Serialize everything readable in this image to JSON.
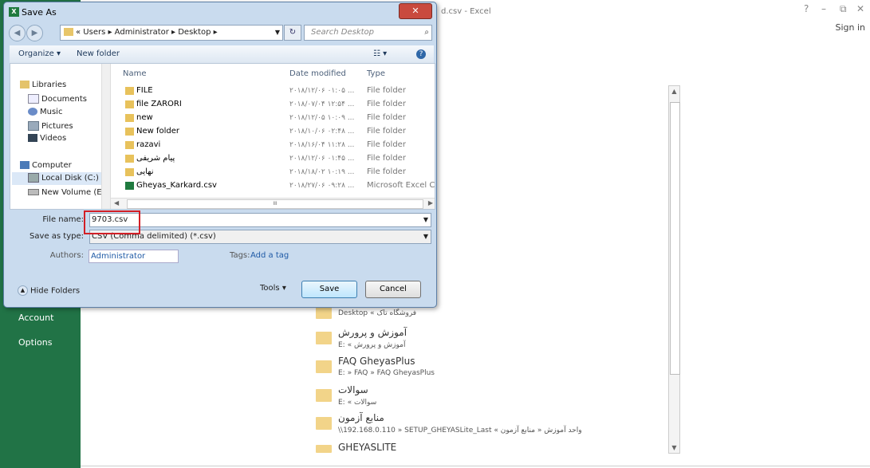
{
  "excel": {
    "title_fragment": "d.csv - Excel",
    "help": "?",
    "minimize": "–",
    "restore": "⧉",
    "close": "✕",
    "sign_in": "Sign in",
    "menu": [
      "Account",
      "Options"
    ],
    "recent": [
      {
        "name": "",
        "path": "Desktop « فروشگاه تاک"
      },
      {
        "name": "آموزش و پرورش",
        "path": "E: « آموزش و پرورش"
      },
      {
        "name": "FAQ GheyasPlus",
        "path": "E: » FAQ » FAQ GheyasPlus"
      },
      {
        "name": "سوالات",
        "path": "E: « سوالات"
      },
      {
        "name": "منابع آزمون",
        "path": "\\\\192.168.0.110 » SETUP_GHEYASLite_Last « واحد آموزش « منابع آزمون"
      },
      {
        "name": "GHEYASLITE",
        "path": ""
      }
    ]
  },
  "dialog": {
    "icon_label": "X",
    "title": "Save As",
    "close_label": "✕",
    "back": "◀",
    "forward": "▶",
    "address_crumbs": "« Users ▸ Administrator ▸ Desktop ▸",
    "refresh": "↻",
    "search_placeholder": "Search Desktop",
    "search_icon": "🔍",
    "toolbar": {
      "organize": "Organize ▾",
      "new_folder": "New folder",
      "views": "☷ ▾",
      "help": "?"
    },
    "nav_tree": [
      "Libraries",
      "Documents",
      "Music",
      "Pictures",
      "Videos",
      "Computer",
      "Local Disk (C:)",
      "New Volume (E:)"
    ],
    "columns": {
      "name": "Name",
      "date": "Date modified",
      "type": "Type"
    },
    "files": [
      {
        "name": "FILE",
        "date": "۲۰۱۸/۱۲/۰۶ ۰۱:۰۵ ...",
        "type": "File folder",
        "icon": "folder"
      },
      {
        "name": "file ZARORI",
        "date": "۲۰۱۸/۰۷/۰۴ ۱۲:۵۴ ...",
        "type": "File folder",
        "icon": "folder"
      },
      {
        "name": "new",
        "date": "۲۰۱۸/۱۲/۰۵ ۱۰:۰۹ ...",
        "type": "File folder",
        "icon": "folder"
      },
      {
        "name": "New folder",
        "date": "۲۰۱۸/۱۰/۰۶ ۰۲:۴۸ ...",
        "type": "File folder",
        "icon": "folder"
      },
      {
        "name": "razavi",
        "date": "۲۰۱۸/۱۶/۰۴ ۱۱:۲۸ ...",
        "type": "File folder",
        "icon": "folder"
      },
      {
        "name": "پیام شریفی",
        "date": "۲۰۱۸/۱۲/۰۶ ۰۱:۴۵ ...",
        "type": "File folder",
        "icon": "folder"
      },
      {
        "name": "نهایی",
        "date": "۲۰۱۸/۱۸/۰۲ ۱۰:۱۹ ...",
        "type": "File folder",
        "icon": "folder"
      },
      {
        "name": "Gheyas_Karkard.csv",
        "date": "۲۰۱۸/۲۷/۰۶ ۰۹:۲۸ ...",
        "type": "Microsoft Excel C...",
        "icon": "excel"
      }
    ],
    "hscroll_grip": "III",
    "file_name_label": "File name:",
    "file_name_value": "9703.csv",
    "save_type_label": "Save as type:",
    "save_type_value": "CSV (Comma delimited) (*.csv)",
    "authors_label": "Authors:",
    "authors_value": "Administrator",
    "tags_label": "Tags:",
    "tags_link": "Add a tag",
    "hide_folders": "Hide Folders",
    "tools": "Tools ▾",
    "save": "Save",
    "cancel": "Cancel"
  }
}
